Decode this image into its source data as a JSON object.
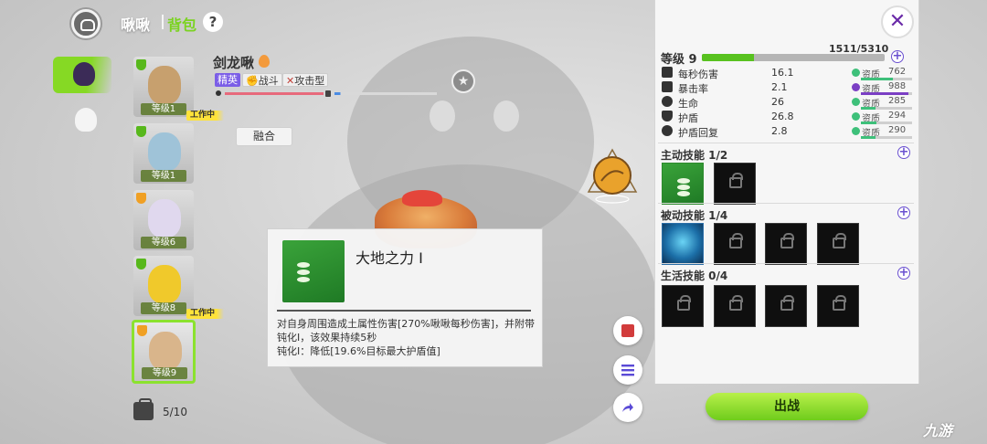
{
  "header": {
    "title": "啾啾",
    "tab": "背包",
    "help": "?"
  },
  "pets": [
    {
      "level": "等级1",
      "working": "工作中",
      "color": "#c7a06e",
      "shield": "green"
    },
    {
      "level": "等级1",
      "working": "",
      "color": "#9fc3d8",
      "shield": "green"
    },
    {
      "level": "等级6",
      "working": "",
      "color": "#e0d8ee",
      "shield": "orange"
    },
    {
      "level": "等级8",
      "working": "工作中",
      "color": "#f0c92b",
      "shield": "green"
    },
    {
      "level": "等级9",
      "working": "",
      "color": "#d9b58b",
      "shield": "orange",
      "selected": true
    }
  ],
  "bag": {
    "count": "5/10"
  },
  "pet_info": {
    "name": "剑龙啾",
    "tags": [
      "精英",
      "战斗",
      "攻击型"
    ],
    "fuse": "融合"
  },
  "tooltip": {
    "title": "大地之力 I",
    "desc": "对自身周围造成土属性伤害[270%啾啾每秒伤害]，并附带钝化Ⅰ，该效果持续5秒",
    "desc2": "钝化Ⅰ：降低[19.6%目标最大护盾值]"
  },
  "panel": {
    "close": "✕",
    "level_label": "等级 9",
    "xp": "1511/5310",
    "xp_fraction": 0.285,
    "stats": [
      {
        "name": "每秒伤害",
        "value": "16.1",
        "apt_label": "资质",
        "apt": "762",
        "apt_color": "#3ec07a",
        "apt_fraction": 0.62
      },
      {
        "name": "暴击率",
        "value": "2.1",
        "apt_label": "资质",
        "apt": "988",
        "apt_color": "#7b3fc4",
        "apt_fraction": 0.92
      },
      {
        "name": "生命",
        "value": "26",
        "apt_label": "资质",
        "apt": "285",
        "apt_color": "#3ec07a",
        "apt_fraction": 0.28
      },
      {
        "name": "护盾",
        "value": "26.8",
        "apt_label": "资质",
        "apt": "294",
        "apt_color": "#3ec07a",
        "apt_fraction": 0.3
      },
      {
        "name": "护盾回复",
        "value": "2.8",
        "apt_label": "资质",
        "apt": "290",
        "apt_color": "#3ec07a",
        "apt_fraction": 0.29
      }
    ],
    "sections": [
      {
        "title": "主动技能  1/2"
      },
      {
        "title": "被动技能  1/4"
      },
      {
        "title": "生活技能  0/4"
      }
    ],
    "go": "出战"
  },
  "watermark": "九游"
}
